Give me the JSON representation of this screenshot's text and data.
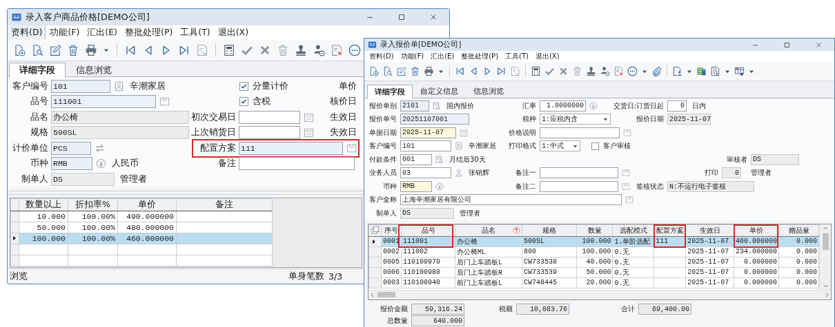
{
  "customer_price_window": {
    "title": "录入客户商品价格[DEMO公司]",
    "menu": [
      {
        "label": "资料(D)",
        "selected": true
      },
      {
        "label": "功能(F)",
        "selected": false
      },
      {
        "label": "汇出(E)",
        "selected": false
      },
      {
        "label": "整批处理(P)",
        "selected": false
      },
      {
        "label": "工具(T)",
        "selected": false
      },
      {
        "label": "退出(X)",
        "selected": false
      }
    ],
    "tabs": [
      {
        "label": "详细字段",
        "selected": true
      },
      {
        "label": "信息浏览",
        "selected": false
      }
    ],
    "form_rows": [
      {
        "a": [
          {
            "kind": "field",
            "label": "客户编号",
            "value": "101",
            "readonly": false,
            "note": "辛潮家居"
          }
        ],
        "b": [
          {
            "kind": "checkbox",
            "label": "分量计价",
            "checked": true
          }
        ],
        "c": [
          {
            "kind": "label",
            "label": "单价"
          }
        ]
      },
      {
        "a": [
          {
            "kind": "field",
            "label": "品号",
            "value": "111001",
            "readonly": false
          }
        ],
        "b": [
          {
            "kind": "checkbox",
            "label": "含税",
            "checked": true
          }
        ],
        "c": [
          {
            "kind": "label",
            "label": "核价日"
          }
        ]
      },
      {
        "a": [
          {
            "kind": "field",
            "label": "品名",
            "value": "办公椅",
            "readonly": true
          }
        ],
        "b": [
          {
            "kind": "field",
            "label": "初次交易日",
            "readonly": false
          }
        ],
        "c": [
          {
            "kind": "label",
            "label": "生效日"
          }
        ]
      },
      {
        "a": [
          {
            "kind": "field",
            "label": "规格",
            "value": "500SL",
            "readonly": true
          }
        ],
        "b": [
          {
            "kind": "field",
            "label": "上次销货日",
            "readonly": false
          }
        ],
        "c": [
          {
            "kind": "label",
            "label": "失效日"
          }
        ]
      },
      {
        "a": [
          {
            "kind": "field",
            "label": "计价单位",
            "value": "PCS",
            "readonly": false
          }
        ],
        "b": [
          {
            "kind": "field",
            "label": "配置方案",
            "value": "111",
            "readonly": false,
            "highlighted": true
          }
        ]
      },
      {
        "a": [
          {
            "kind": "field",
            "label": "币种",
            "value": "RMB",
            "readonly": false,
            "note": "人民币"
          }
        ],
        "b": [
          {
            "kind": "field",
            "label": "备注",
            "readonly": false
          }
        ]
      },
      {
        "a": [
          {
            "kind": "field",
            "label": "制单人",
            "value": "DS",
            "readonly": true,
            "note": "管理者"
          }
        ]
      }
    ],
    "price_tiers": {
      "columns": [
        "数量以上",
        "折扣率%",
        "单价",
        "备注"
      ],
      "rows": [
        {
          "cells": [
            "10.000",
            "100.00%",
            "490.000000"
          ],
          "selected": false
        },
        {
          "cells": [
            "50.000",
            "100.00%",
            "480.000000"
          ],
          "selected": false
        },
        {
          "cells": [
            "100.000",
            "100.00%",
            "460.000000"
          ],
          "selected": true
        }
      ]
    },
    "status_bar": {
      "mode": "浏览",
      "count_label": "单身笔数",
      "count": "3/3"
    }
  },
  "quotation_window": {
    "title": "录入报价单[DEMO公司]",
    "menu": [
      {
        "label": "资料(D)",
        "selected": false
      },
      {
        "label": "功能(F)",
        "selected": false
      },
      {
        "label": "汇出(E)",
        "selected": false
      },
      {
        "label": "整批处理(P)",
        "selected": false
      },
      {
        "label": "工具(T)",
        "selected": false
      },
      {
        "label": "退出(X)",
        "selected": false
      }
    ],
    "tabs": [
      {
        "label": "详细字段",
        "selected": true
      },
      {
        "label": "自定义信息",
        "selected": false
      },
      {
        "label": "信息浏览",
        "selected": false
      }
    ],
    "form_rows": [
      {
        "a": [
          {
            "kind": "field",
            "label": "报价单别",
            "value": "2101",
            "readonly": false,
            "required": false,
            "note": "国内报价"
          }
        ],
        "b": [
          {
            "kind": "field",
            "label": "汇率",
            "value": "1.0000000",
            "readonly": false,
            "required": false,
            "numeric": true
          }
        ],
        "c": [
          {
            "kind": "field",
            "label": "交货日:订货日起",
            "value": "0",
            "readonly": false,
            "required": false,
            "numeric": true,
            "note": "日内"
          }
        ]
      },
      {
        "a": [
          {
            "kind": "field",
            "label": "报价单号",
            "value": "20251107001",
            "readonly": false,
            "required": false
          }
        ],
        "b": [
          {
            "kind": "select",
            "label": "税种",
            "value": "1:应税内含"
          }
        ],
        "c": [
          {
            "kind": "field",
            "label": "报价日期",
            "value": "2025-11-07",
            "readonly": true,
            "required": false
          }
        ]
      },
      {
        "a": [
          {
            "kind": "field",
            "label": "单据日期",
            "value": "2025-11-07",
            "readonly": false,
            "required": true
          }
        ],
        "b": [
          {
            "kind": "field",
            "label": "价格说明",
            "readonly": false,
            "required": false
          }
        ]
      },
      {
        "a": [
          {
            "kind": "field",
            "label": "客户编号",
            "value": "101",
            "readonly": false,
            "required": false,
            "note": "辛潮家居"
          }
        ],
        "b": [
          {
            "kind": "select",
            "label": "打印格式",
            "value": "1:中式"
          },
          {
            "kind": "checkbox",
            "label": "客户审核",
            "checked": false
          }
        ]
      },
      {
        "a": [
          {
            "kind": "field",
            "label": "付款条件",
            "value": "001",
            "readonly": false,
            "required": false,
            "note": "月结后30天"
          }
        ],
        "c": [
          {
            "kind": "field",
            "label": "审核者",
            "value": "DS",
            "readonly": true,
            "required": false
          }
        ]
      },
      {
        "a": [
          {
            "kind": "field",
            "label": "业务人员",
            "value": "03",
            "readonly": false,
            "required": false,
            "note": "张销辉"
          }
        ],
        "b": [
          {
            "kind": "field",
            "label": "备注一",
            "readonly": false,
            "required": false
          }
        ],
        "c": [
          {
            "kind": "field",
            "label": "打印",
            "value": "0",
            "readonly": true,
            "required": false,
            "numeric": true,
            "note": "管理者"
          }
        ]
      },
      {
        "a": [
          {
            "kind": "field",
            "label": "币种",
            "value": "RMB",
            "readonly": false,
            "required": true
          }
        ],
        "b": [
          {
            "kind": "field",
            "label": "备注二",
            "readonly": false,
            "required": false
          }
        ],
        "c": [
          {
            "kind": "field",
            "label": "签核状态",
            "value": "N:不运行电子签核",
            "readonly": true,
            "required": false
          }
        ]
      },
      {
        "a": [
          {
            "kind": "field",
            "label": "客户全称",
            "value": "上海辛潮家居有限公司",
            "readonly": false,
            "required": false
          }
        ]
      },
      {
        "a": [
          {
            "kind": "field",
            "label": "制单人",
            "value": "DS",
            "readonly": true,
            "required": false,
            "note": "管理者"
          }
        ]
      }
    ],
    "table": {
      "columns": [
        {
          "label": "序号",
          "numeric": false,
          "sorted": false,
          "highlighted": false
        },
        {
          "label": "品号",
          "numeric": false,
          "sorted": false,
          "highlighted": true
        },
        {
          "label": "品名",
          "numeric": false,
          "sorted": true,
          "highlighted": false
        },
        {
          "label": "规格",
          "numeric": false,
          "sorted": false,
          "highlighted": false
        },
        {
          "label": "数量",
          "numeric": true,
          "sorted": false,
          "highlighted": false
        },
        {
          "label": "选配模式",
          "numeric": false,
          "sorted": false,
          "highlighted": false
        },
        {
          "label": "配置方案",
          "numeric": false,
          "sorted": false,
          "highlighted": true
        },
        {
          "label": "生效日",
          "numeric": false,
          "sorted": false,
          "highlighted": false
        },
        {
          "label": "单价",
          "numeric": true,
          "sorted": false,
          "highlighted": true
        },
        {
          "label": "赠品量",
          "numeric": true,
          "sorted": false,
          "highlighted": false
        }
      ],
      "rows": [
        {
          "selected": true,
          "cells": [
            "0001",
            "111001",
            "办公椅",
            "500SL",
            "100.000",
            "1.单阶选配",
            "111",
            "2025-11-07",
            "460.000000",
            "0.000"
          ]
        },
        {
          "selected": false,
          "cells": [
            "0002",
            "111002",
            "办公椅ML",
            "800",
            "100.000",
            "0.无",
            null,
            "2025-11-07",
            "234.000000",
            "0.000"
          ]
        },
        {
          "selected": false,
          "cells": [
            "0005",
            "110100970",
            "后门上车踏板L",
            "CW733538",
            "40.000",
            "0.无",
            null,
            "2025-11-07",
            "0.000000",
            "0.000"
          ]
        },
        {
          "selected": false,
          "cells": [
            "0006",
            "110100980",
            "后门上车踏板R",
            "CW733539",
            "50.000",
            "0.无",
            null,
            "2025-11-07",
            "0.000000",
            "0.000"
          ]
        },
        {
          "selected": false,
          "cells": [
            "0003",
            "110100940",
            "前门上车踏板L",
            "CW748445",
            "20.000",
            "0.无",
            null,
            "2025-11-07",
            "0.000000",
            "0.000"
          ]
        }
      ]
    },
    "totals": [
      {
        "label": "报价金额",
        "value": "59,316.24"
      },
      {
        "label": "税额",
        "value": "10,083.76"
      },
      {
        "label": "合计",
        "value": "69,400.00"
      },
      {
        "label": "总数量",
        "value": "640.000"
      }
    ]
  }
}
